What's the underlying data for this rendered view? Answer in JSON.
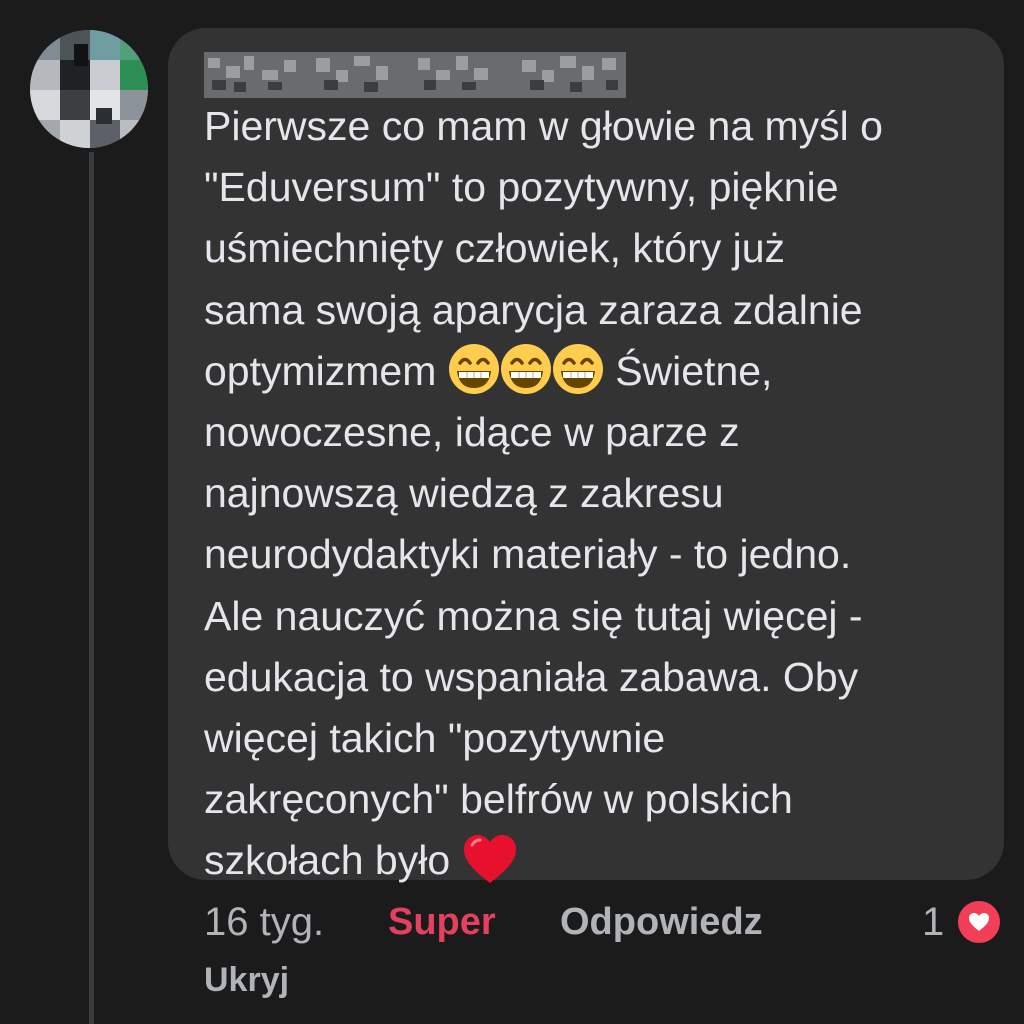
{
  "comment": {
    "lines": [
      "Pierwsze co mam w głowie na myśl o",
      "\"Eduversum\" to pozytywny, pięknie",
      "uśmiechnięty człowiek, który już",
      "sama swoją aparycja zaraza zdalnie",
      "optymizmem",
      "Świetne,",
      "nowoczesne, idące w parze z",
      "najnowszą wiedzą z zakresu",
      "neurodydaktyki materiały - to jedno.",
      "Ale nauczyć można się tutaj więcej -",
      "edukacja to wspaniała zabawa. Oby",
      "więcej takich \"pozytywnie",
      "zakręconych\" belfrów w polskich",
      "szkołach było"
    ],
    "emojis": [
      "grinning-face-icon",
      "grinning-face-icon",
      "grinning-face-icon",
      "red-heart-icon"
    ]
  },
  "actions": {
    "time": "16 tyg.",
    "reaction_label": "Super",
    "reply_label": "Odpowiedz",
    "reaction_count": "1",
    "hide_label": "Ukryj"
  },
  "colors": {
    "background": "#1b1b1c",
    "bubble": "#333334",
    "text": "#e4e6eb",
    "muted": "#b0b3b8",
    "reaction_accent": "#e4405f",
    "heart": "#f33e58"
  }
}
